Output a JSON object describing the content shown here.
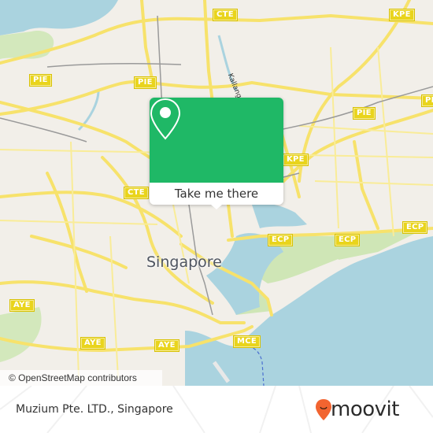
{
  "map": {
    "city_label": "Singapore",
    "river_label": "Kallang River",
    "shields": [
      {
        "label": "CTE",
        "id": "cte-north"
      },
      {
        "label": "KPE",
        "id": "kpe-north"
      },
      {
        "label": "PIE",
        "id": "pie-west-1"
      },
      {
        "label": "PIE",
        "id": "pie-west-2"
      },
      {
        "label": "PIE",
        "id": "pie-east"
      },
      {
        "label": "PIE",
        "id": "pie-far-east"
      },
      {
        "label": "KPE",
        "id": "kpe-south"
      },
      {
        "label": "CTE",
        "id": "cte-south"
      },
      {
        "label": "ECP",
        "id": "ecp-1"
      },
      {
        "label": "ECP",
        "id": "ecp-2"
      },
      {
        "label": "ECP",
        "id": "ecp-3"
      },
      {
        "label": "AYE",
        "id": "aye-west"
      },
      {
        "label": "AYE",
        "id": "aye-mid"
      },
      {
        "label": "AYE",
        "id": "aye-east"
      },
      {
        "label": "MCE",
        "id": "mce"
      }
    ],
    "attribution": "© OpenStreetMap contributors",
    "colors": {
      "land": "#f2efe9",
      "water": "#aad3df",
      "park": "#cde6b4",
      "road": "#f7e26b",
      "rail": "#999999"
    }
  },
  "popup": {
    "icon": "map-pin-icon",
    "button_label": "Take me there",
    "color": "#1fb866"
  },
  "footer": {
    "place_name": "Muzium Pte. LTD., Singapore",
    "logo_text": "moovit",
    "logo_color": "#f26430"
  }
}
